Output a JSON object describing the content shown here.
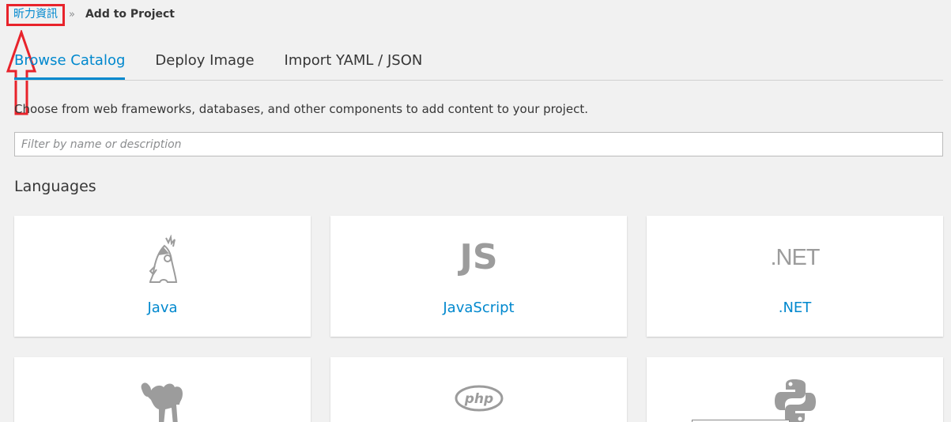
{
  "breadcrumb": {
    "project_link": "昕力資訊",
    "separator": "»",
    "current": "Add to Project"
  },
  "tabs": [
    {
      "label": "Browse Catalog",
      "active": true
    },
    {
      "label": "Deploy Image",
      "active": false
    },
    {
      "label": "Import YAML / JSON",
      "active": false
    }
  ],
  "intro": "Choose from web frameworks, databases, and other components to add content to your project.",
  "filter": {
    "placeholder": "Filter by name or description",
    "value": ""
  },
  "section": {
    "title": "Languages"
  },
  "cards": [
    {
      "label": "Java",
      "icon": "java-duke-icon"
    },
    {
      "label": "JavaScript",
      "icon": "javascript-icon",
      "icon_text": "JS"
    },
    {
      "label": ".NET",
      "icon": "dotnet-icon",
      "icon_text": ".NET"
    },
    {
      "label": "",
      "icon": "perl-camel-icon"
    },
    {
      "label": "",
      "icon": "php-icon",
      "icon_text": "php"
    },
    {
      "label": "",
      "icon": "python-icon"
    }
  ],
  "colors": {
    "accent": "#0088ce",
    "annotation": "#e8232b",
    "background": "#f1f1f1",
    "icon_gray": "#9c9c9c"
  }
}
